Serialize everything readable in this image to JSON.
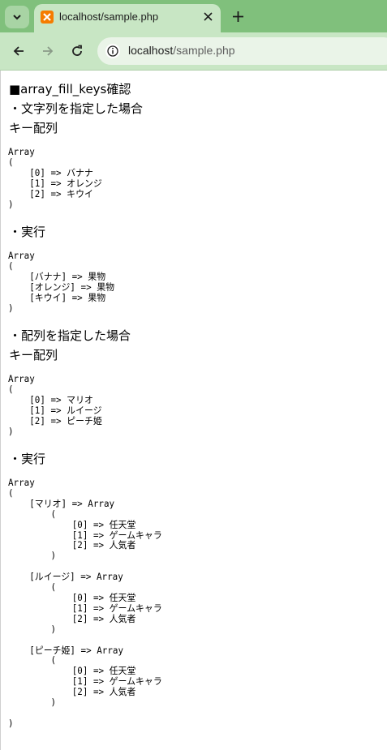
{
  "browser": {
    "tab_title": "localhost/sample.php",
    "url_host": "localhost",
    "url_path": "/sample.php"
  },
  "content": {
    "heading": "■array_fill_keys確認",
    "section1_title": "・文字列を指定した場合",
    "section1_key_label": "キー配列",
    "section1_keys_dump": "Array\n(\n    [0] => バナナ\n    [1] => オレンジ\n    [2] => キウイ\n)",
    "section1_run_label": "・実行",
    "section1_result_dump": "Array\n(\n    [バナナ] => 果物\n    [オレンジ] => 果物\n    [キウイ] => 果物\n)",
    "section2_title": "・配列を指定した場合",
    "section2_key_label": "キー配列",
    "section2_keys_dump": "Array\n(\n    [0] => マリオ\n    [1] => ルイージ\n    [2] => ピーチ姫\n)",
    "section2_run_label": "・実行",
    "section2_result_dump": "Array\n(\n    [マリオ] => Array\n        (\n            [0] => 任天堂\n            [1] => ゲームキャラ\n            [2] => 人気者\n        )\n\n    [ルイージ] => Array\n        (\n            [0] => 任天堂\n            [1] => ゲームキャラ\n            [2] => 人気者\n        )\n\n    [ピーチ姫] => Array\n        (\n            [0] => 任天堂\n            [1] => ゲームキャラ\n            [2] => 人気者\n        )\n\n)"
  },
  "icons": {
    "tab_menu": "chevron-down-icon",
    "favicon": "xampp-icon",
    "close": "close-icon",
    "new_tab": "plus-icon",
    "back": "arrow-left-icon",
    "forward": "arrow-right-icon",
    "reload": "reload-icon",
    "site_info": "info-icon"
  },
  "colors": {
    "tab_strip": "#80c07c",
    "toolbar": "#c8e6c4",
    "favicon": "#f57c00"
  }
}
